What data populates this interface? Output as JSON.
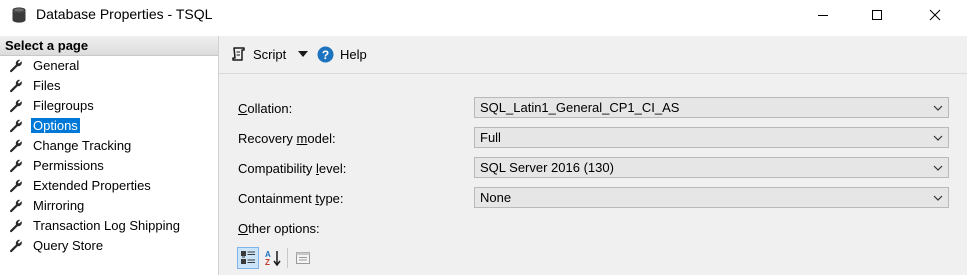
{
  "window": {
    "title": "Database Properties - TSQL",
    "icon": "database-icon",
    "controls": [
      "minimize-icon",
      "maximize-icon",
      "close-icon"
    ]
  },
  "sidebar": {
    "header": "Select a page",
    "items": [
      {
        "label": "General",
        "icon": "wrench-icon",
        "selected": false
      },
      {
        "label": "Files",
        "icon": "wrench-icon",
        "selected": false
      },
      {
        "label": "Filegroups",
        "icon": "wrench-icon",
        "selected": false
      },
      {
        "label": "Options",
        "icon": "wrench-icon",
        "selected": true
      },
      {
        "label": "Change Tracking",
        "icon": "wrench-icon",
        "selected": false
      },
      {
        "label": "Permissions",
        "icon": "wrench-icon",
        "selected": false
      },
      {
        "label": "Extended Properties",
        "icon": "wrench-icon",
        "selected": false
      },
      {
        "label": "Mirroring",
        "icon": "wrench-icon",
        "selected": false
      },
      {
        "label": "Transaction Log Shipping",
        "icon": "wrench-icon",
        "selected": false
      },
      {
        "label": "Query Store",
        "icon": "wrench-icon",
        "selected": false
      }
    ]
  },
  "toolbar": {
    "script_label": "Script",
    "help_label": "Help"
  },
  "options": {
    "collation": {
      "label_pre": "",
      "label_u": "C",
      "label_post": "ollation:",
      "value": "SQL_Latin1_General_CP1_CI_AS"
    },
    "recovery_model": {
      "label_pre": "Recovery ",
      "label_u": "m",
      "label_post": "odel:",
      "value": "Full"
    },
    "compatibility_level": {
      "label_pre": "Compatibility ",
      "label_u": "l",
      "label_post": "evel:",
      "value": "SQL Server 2016 (130)"
    },
    "containment_type": {
      "label_pre": "Containment ",
      "label_u": "t",
      "label_post": "ype:",
      "value": "None"
    },
    "other_options": {
      "label_pre": "",
      "label_u": "O",
      "label_post": "ther options:"
    }
  },
  "colors": {
    "selection": "#0078d7",
    "panel_bg": "#f0f0f0",
    "combo_bg": "#e6e6e6",
    "help_icon": "#1e73be"
  }
}
